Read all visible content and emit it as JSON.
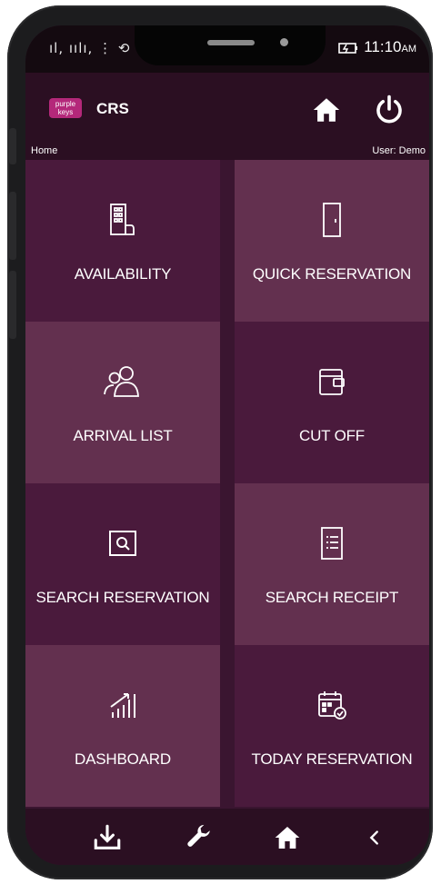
{
  "status": {
    "signal": "ıl, ıılı, ⋮ ⟲",
    "time": "11:10",
    "ampm": "AM"
  },
  "app": {
    "logo_text": "purple keys",
    "title": "CRS"
  },
  "breadcrumb": {
    "location": "Home",
    "user": "User: Demo"
  },
  "tiles": [
    {
      "label": "AVAILABILITY",
      "icon": "building-icon"
    },
    {
      "label": "QUICK RESERVATION",
      "icon": "door-icon"
    },
    {
      "label": "ARRIVAL LIST",
      "icon": "users-icon"
    },
    {
      "label": "CUT OFF",
      "icon": "wallet-icon"
    },
    {
      "label": "SEARCH RESERVATION",
      "icon": "search-icon"
    },
    {
      "label": "SEARCH RECEIPT",
      "icon": "receipt-icon"
    },
    {
      "label": "DASHBOARD",
      "icon": "bar-chart-icon"
    },
    {
      "label": "TODAY RESERVATION",
      "icon": "calendar-check-icon"
    }
  ],
  "bottom_nav": [
    {
      "icon": "download-icon"
    },
    {
      "icon": "wrench-icon"
    },
    {
      "icon": "home-icon"
    },
    {
      "icon": "back-icon"
    }
  ],
  "colors": {
    "tile_dark": "#4a1a3c",
    "tile_light": "#63304f",
    "bar": "#2b0f22",
    "logo": "#b4287a"
  }
}
